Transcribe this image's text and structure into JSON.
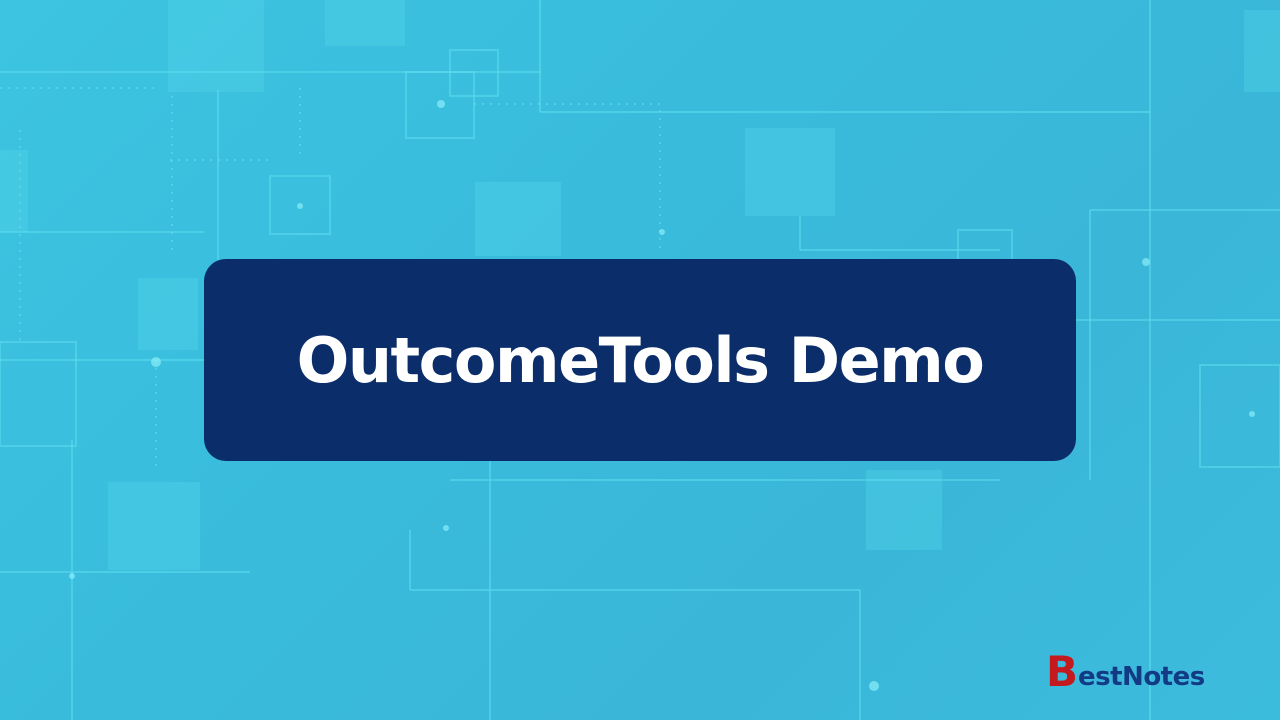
{
  "title_card": {
    "title": "OutcomeTools Demo"
  },
  "logo": {
    "initial": "B",
    "rest": "estNotes"
  },
  "colors": {
    "background": "#3cbcdc",
    "card": "#0b2e6b",
    "title_text": "#ffffff",
    "logo_initial": "#c21a1e",
    "logo_rest": "#123a85"
  }
}
